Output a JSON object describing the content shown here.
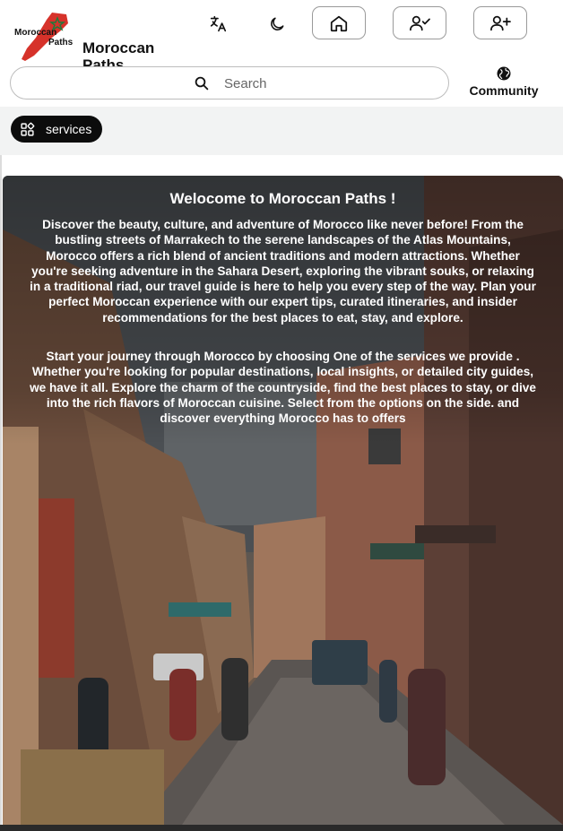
{
  "header": {
    "logo": {
      "line1": "Moroccan",
      "line2": "Paths",
      "colors": {
        "map": "#d6322a",
        "star": "#1f7a3a"
      }
    },
    "brand_title": "Moroccan Paths",
    "toolbar": {
      "translate_icon": "translate-icon",
      "theme_icon": "moon-icon",
      "home_icon": "home-icon",
      "login_icon": "user-check-icon",
      "register_icon": "user-plus-icon"
    },
    "search": {
      "placeholder": "Search",
      "icon": "search-icon"
    },
    "community": {
      "label": "Community",
      "icon": "globe-icon"
    }
  },
  "nav": {
    "services": {
      "label": "services",
      "icon": "grid-icon"
    }
  },
  "hero": {
    "title": "Welocome to Moroccan Paths !",
    "paragraph1": "Discover the beauty, culture, and adventure of Morocco like never before! From the bustling streets of Marrakech to the serene landscapes of the Atlas Mountains, Morocco offers a rich blend of ancient traditions and modern attractions. Whether you're seeking adventure in the Sahara Desert, exploring the vibrant souks, or relaxing in a traditional riad, our travel guide is here to help you every step of the way. Plan your perfect Moroccan experience with our expert tips, curated itineraries, and insider recommendations for the best places to eat, stay, and explore.",
    "paragraph2": "Start your journey through Morocco by choosing One of the services we provide . Whether you're looking for popular destinations, local insights, or detailed city guides, we have it all. Explore the charm of the countryside, find the best places to stay, or dive into the rich flavors of Moroccan cuisine. Select from the options on the side. and discover everything Morocco has to offers",
    "background": "marrakech-street-photo"
  }
}
